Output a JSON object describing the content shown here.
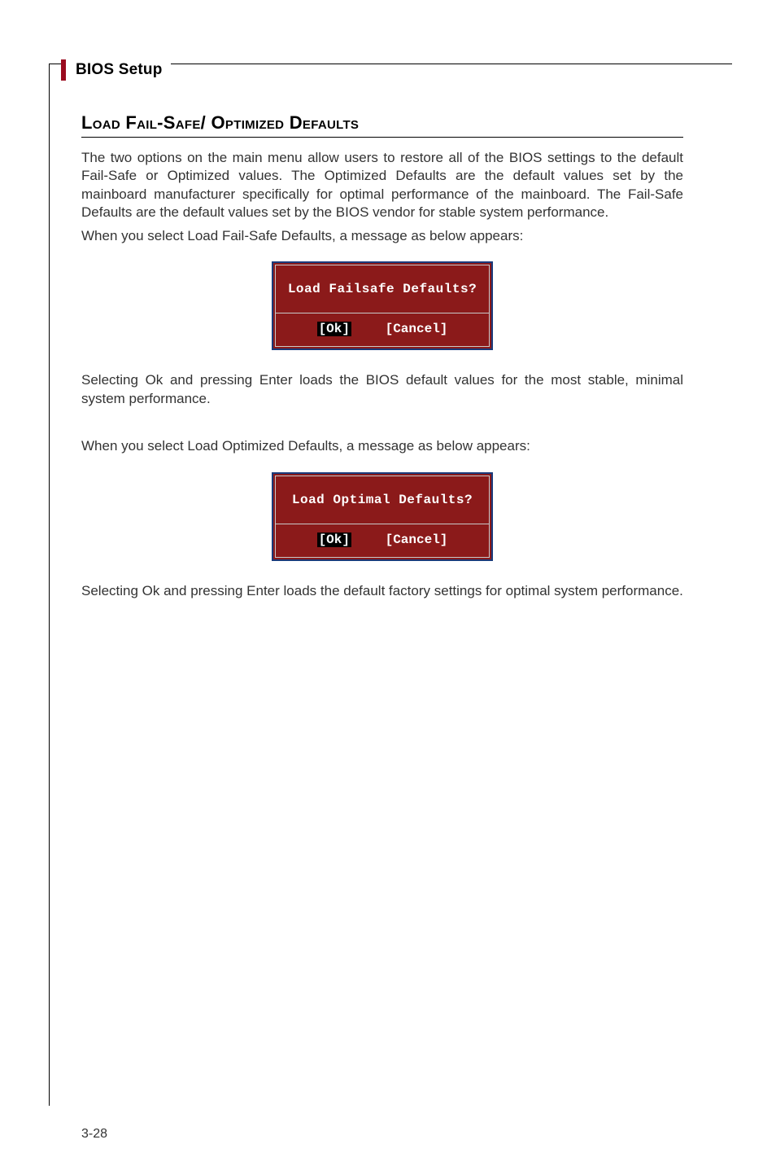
{
  "header": {
    "title": "BIOS Setup"
  },
  "section": {
    "title": "Load Fail-Safe/ Optimized Defaults"
  },
  "paragraphs": {
    "intro": "The two options on the main menu allow users to restore all of the BIOS settings to the default Fail-Safe or Optimized values. The Optimized Defaults are the default values set by the mainboard manufacturer specifically for optimal performance of the mainboard. The Fail-Safe Defaults are the default values set by the BIOS vendor for stable system performance.",
    "lead_failsafe": "When you select Load Fail-Safe Defaults, a message as below appears:",
    "after_failsafe": "Selecting Ok and pressing Enter loads the BIOS default values for the most stable, minimal system performance.",
    "lead_optimized": "When you select Load Optimized Defaults, a message as below appears:",
    "after_optimized": "Selecting Ok and pressing Enter loads the default factory settings for optimal system performance."
  },
  "dialogs": {
    "failsafe": {
      "question": "Load Failsafe Defaults?",
      "ok": "[Ok]",
      "cancel": "[Cancel]"
    },
    "optimal": {
      "question": "Load Optimal Defaults?",
      "ok": "[Ok]",
      "cancel": "[Cancel]"
    }
  },
  "page_number": "3-28"
}
